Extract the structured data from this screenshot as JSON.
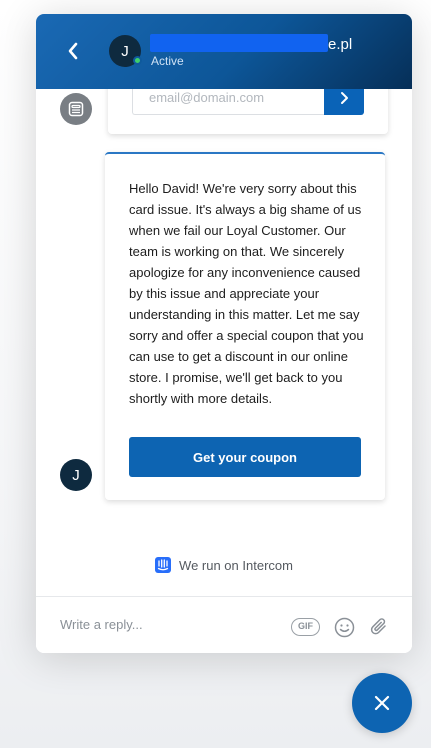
{
  "header": {
    "avatar_initial": "J",
    "name_visible_suffix": "e.pl",
    "status": "Active"
  },
  "email_capture": {
    "placeholder": "email@domain.com"
  },
  "message": {
    "text": "Hello David! We're very sorry about this card issue. It's always a big shame of us when we fail our Loyal Customer. Our team is working on that. We sincerely apologize for any inconvenience caused by this issue and appreciate your understanding in this matter. Let me say sorry and offer a special coupon that you can use to get a discount in our online store. I promise, we'll get back to you shortly with more details.",
    "button_label": "Get your coupon",
    "author_initial": "J"
  },
  "footer": {
    "powered_by": "We run on Intercom"
  },
  "composer": {
    "placeholder": "Write a reply...",
    "gif_label": "GIF"
  },
  "colors": {
    "brand_blue": "#0d64b2",
    "header_dark": "#062f58",
    "online_green": "#3fcf6c",
    "redaction_blue": "#1163f0"
  },
  "icons": [
    "chevron-left-icon",
    "chevron-right-icon",
    "bot-icon",
    "intercom-icon",
    "emoji-icon",
    "paperclip-icon",
    "close-icon"
  ]
}
